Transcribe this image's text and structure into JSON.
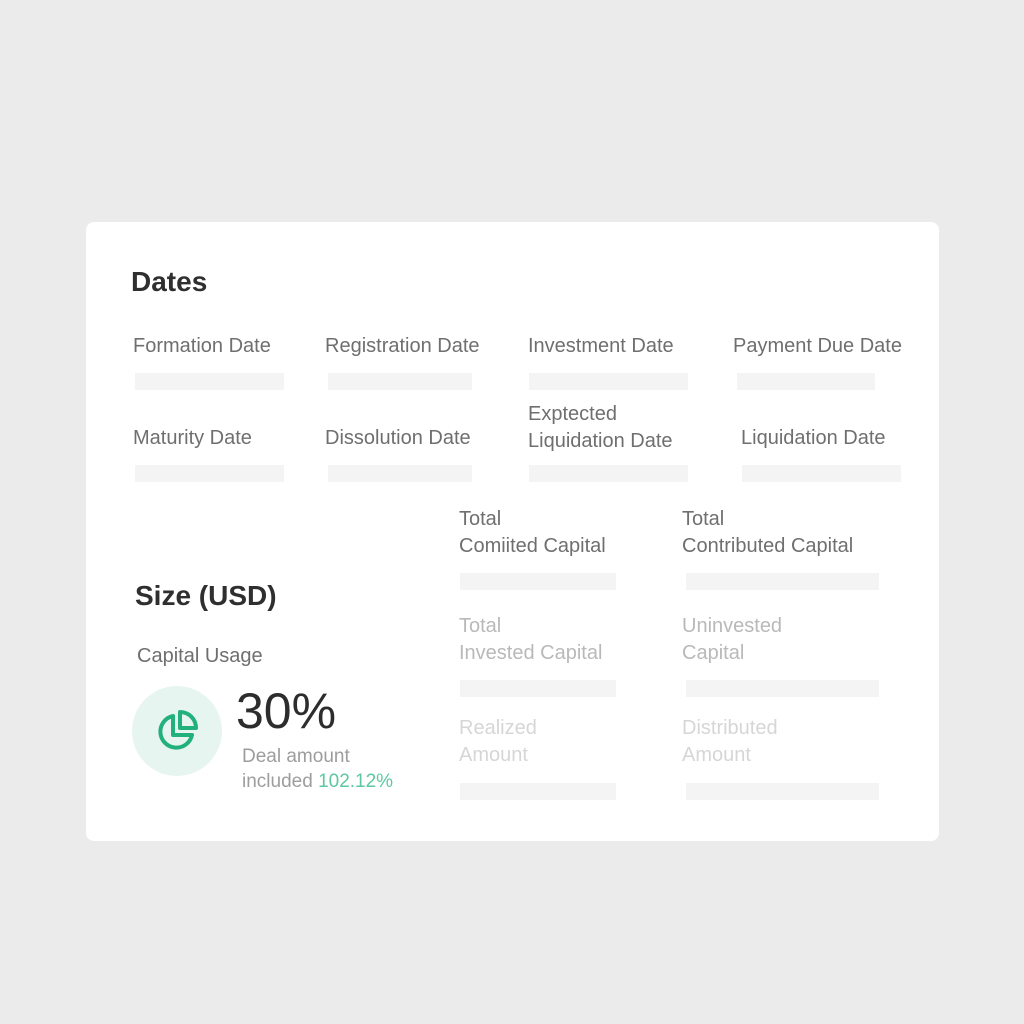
{
  "dates": {
    "title": "Dates",
    "fields": [
      {
        "label": "Formation Date"
      },
      {
        "label": "Registration Date"
      },
      {
        "label": "Investment Date"
      },
      {
        "label": "Payment Due Date"
      },
      {
        "label": "Maturity Date"
      },
      {
        "label": "Dissolution Date"
      },
      {
        "label": "Exptected\nLiquidation Date"
      },
      {
        "label": "Liquidation Date"
      }
    ]
  },
  "size": {
    "title": "Size (USD)",
    "capital_usage_label": "Capital Usage",
    "capital_usage_value": "30%",
    "icon": "pie-chart-icon",
    "deal_amount_text": "Deal amount\nincluded",
    "deal_amount_pct": "102.12%",
    "accent_color": "#22b07d",
    "fields": [
      {
        "label": "Total\nComiited Capital"
      },
      {
        "label": "Total\nContributed Capital"
      },
      {
        "label": "Total\nInvested Capital"
      },
      {
        "label": "Uninvested\nCapital"
      },
      {
        "label": "Realized\nAmount"
      },
      {
        "label": "Distributed\nAmount"
      }
    ]
  }
}
